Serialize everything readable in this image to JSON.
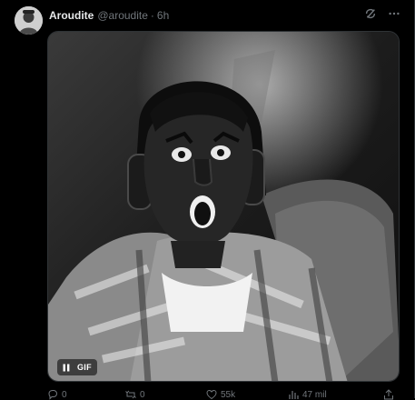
{
  "tweet": {
    "author_name": "Aroudite",
    "author_handle": "@aroudite",
    "separator": "·",
    "time": "6h",
    "header_icons": [
      "grok-icon",
      "more-icon"
    ],
    "media": {
      "badge": "GIF",
      "state": "playing",
      "icon": "pause-icon"
    },
    "actions": {
      "replies": "0",
      "reposts": "0",
      "likes": "55k",
      "views": "47 mil"
    },
    "colors": {
      "background": "#000000",
      "text_primary": "#e7e9ea",
      "text_secondary": "#71767b",
      "border": "#2f3336"
    }
  }
}
